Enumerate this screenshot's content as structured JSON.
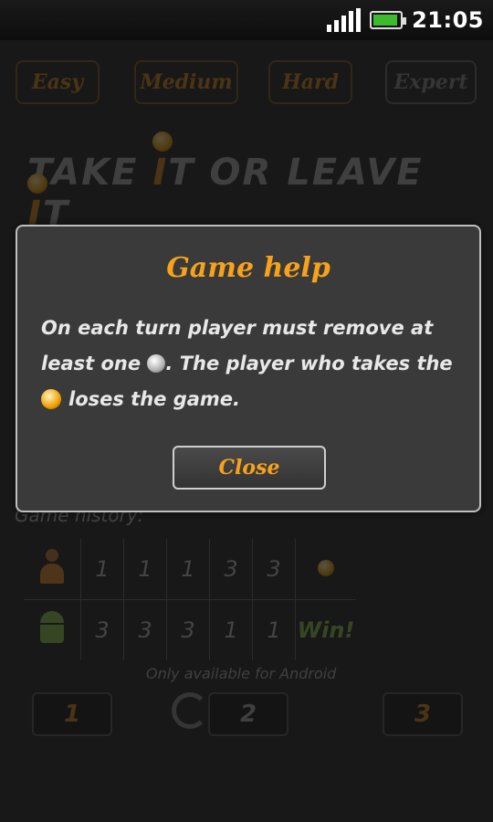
{
  "status_bar": {
    "time": "21:05",
    "signal_icon": "signal-bars-icon",
    "battery_icon": "battery-icon",
    "battery_color": "#3dbb2e"
  },
  "difficulty": {
    "easy": "Easy",
    "medium": "Medium",
    "hard": "Hard",
    "expert": "Expert"
  },
  "title": {
    "part1": "TAKE ",
    "i1": "I",
    "part2": "T OR LEAVE ",
    "i2": "I",
    "part3": "T"
  },
  "history": {
    "label": "Game history:",
    "player_moves": [
      "1",
      "1",
      "1",
      "3",
      "3"
    ],
    "android_moves": [
      "3",
      "3",
      "3",
      "1",
      "1"
    ],
    "android_result": "Win!"
  },
  "android_note": "Only available for Android",
  "buttons": {
    "one": "1",
    "two": "2",
    "three": "3"
  },
  "dialog": {
    "title": "Game help",
    "body_part1": "On each turn player must remove at least one",
    "body_part2": ". The player who takes the",
    "body_part3": "loses the game.",
    "close_label": "Close"
  },
  "colors": {
    "accent": "#f7a21a",
    "win": "#8bc34a",
    "background": "#1e1e1e"
  }
}
